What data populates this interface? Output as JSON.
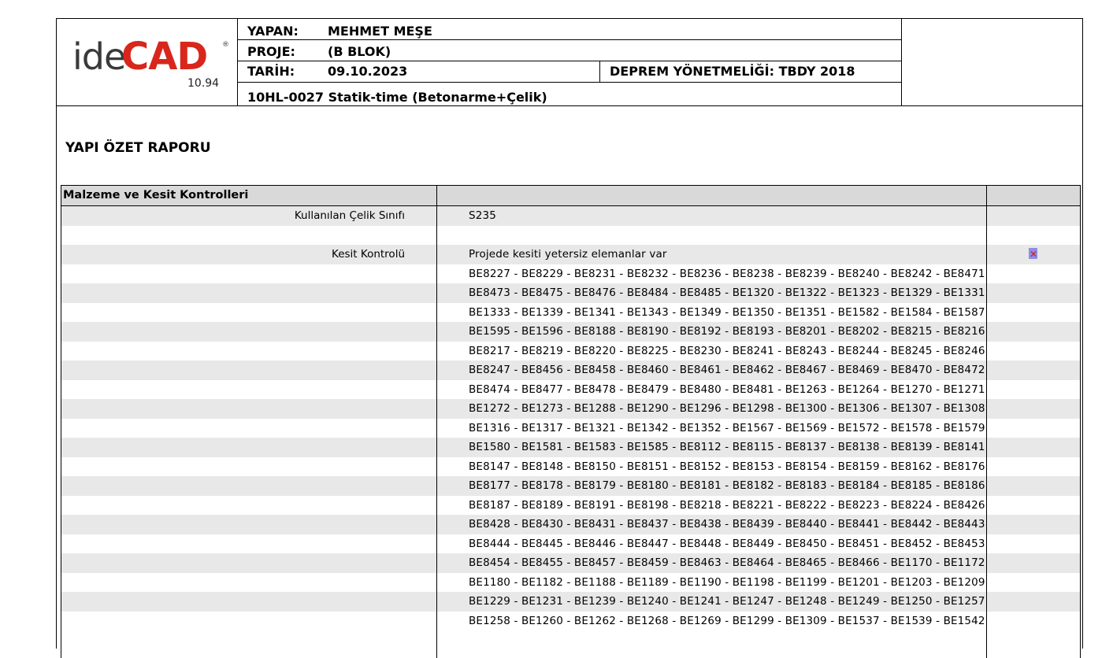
{
  "header": {
    "logo": {
      "ide": "ide",
      "cad": "CAD",
      "reg": "®",
      "version": "10.94"
    },
    "yapan_label": "YAPAN:",
    "yapan_value": "MEHMET MEŞE",
    "proje_label": "PROJE:",
    "proje_value": "(B BLOK)",
    "tarih_label": "TARİH:",
    "tarih_value": "09.10.2023",
    "deprem": "DEPREM YÖNETMELİĞİ: TBDY 2018",
    "project_code": "10HL-0027 Statik-time (Betonarme+Çelik)"
  },
  "report_title": "YAPI ÖZET RAPORU",
  "table": {
    "header": "Malzeme ve Kesit Kontrolleri",
    "rows": [
      {
        "label": "Kullanılan Çelik Sınıfı",
        "text": "S235",
        "shade": true
      },
      {
        "label": "",
        "text": "",
        "shade": false
      },
      {
        "label": "Kesit Kontrolü",
        "text": "Projede kesiti yetersiz elemanlar var",
        "shade": true,
        "status_icon": "x-fail-icon"
      },
      {
        "label": "",
        "text": "BE8227 - BE8229 - BE8231 - BE8232 - BE8236 - BE8238 - BE8239 - BE8240 - BE8242 - BE8471",
        "shade": false
      },
      {
        "label": "",
        "text": "BE8473 - BE8475 - BE8476 - BE8484 - BE8485 - BE1320 - BE1322 - BE1323 - BE1329 - BE1331",
        "shade": true
      },
      {
        "label": "",
        "text": "BE1333 - BE1339 - BE1341 - BE1343 - BE1349 - BE1350 - BE1351 - BE1582 - BE1584 - BE1587",
        "shade": false
      },
      {
        "label": "",
        "text": "BE1595 - BE1596 - BE8188 - BE8190 - BE8192 - BE8193 - BE8201 - BE8202 - BE8215 - BE8216",
        "shade": true
      },
      {
        "label": "",
        "text": "BE8217 - BE8219 - BE8220 - BE8225 - BE8230 - BE8241 - BE8243 - BE8244 - BE8245 - BE8246",
        "shade": false
      },
      {
        "label": "",
        "text": "BE8247 - BE8456 - BE8458 - BE8460 - BE8461 - BE8462 - BE8467 - BE8469 - BE8470 - BE8472",
        "shade": true
      },
      {
        "label": "",
        "text": "BE8474 - BE8477 - BE8478 - BE8479 - BE8480 - BE8481 - BE1263 - BE1264 - BE1270 - BE1271",
        "shade": false
      },
      {
        "label": "",
        "text": "BE1272 - BE1273 - BE1288 - BE1290 - BE1296 - BE1298 - BE1300 - BE1306 - BE1307 - BE1308",
        "shade": true
      },
      {
        "label": "",
        "text": "BE1316 - BE1317 - BE1321 - BE1342 - BE1352 - BE1567 - BE1569 - BE1572 - BE1578 - BE1579",
        "shade": false
      },
      {
        "label": "",
        "text": "BE1580 - BE1581 - BE1583 - BE1585 - BE8112 - BE8115 - BE8137 - BE8138 - BE8139 - BE8141",
        "shade": true
      },
      {
        "label": "",
        "text": "BE8147 - BE8148 - BE8150 - BE8151 - BE8152 - BE8153 - BE8154 - BE8159 - BE8162 - BE8176",
        "shade": false
      },
      {
        "label": "",
        "text": "BE8177 - BE8178 - BE8179 - BE8180 - BE8181 - BE8182 - BE8183 - BE8184 - BE8185 - BE8186",
        "shade": true
      },
      {
        "label": "",
        "text": "BE8187 - BE8189 - BE8191 - BE8198 - BE8218 - BE8221 - BE8222 - BE8223 - BE8224 - BE8426",
        "shade": false
      },
      {
        "label": "",
        "text": "BE8428 - BE8430 - BE8431 - BE8437 - BE8438 - BE8439 - BE8440 - BE8441 - BE8442 - BE8443",
        "shade": true
      },
      {
        "label": "",
        "text": "BE8444 - BE8445 - BE8446 - BE8447 - BE8448 - BE8449 - BE8450 - BE8451 - BE8452 - BE8453",
        "shade": false
      },
      {
        "label": "",
        "text": "BE8454 - BE8455 - BE8457 - BE8459 - BE8463 - BE8464 - BE8465 - BE8466 - BE1170 - BE1172",
        "shade": true
      },
      {
        "label": "",
        "text": "BE1180 - BE1182 - BE1188 - BE1189 - BE1190 - BE1198 - BE1199 - BE1201 - BE1203 - BE1209",
        "shade": false
      },
      {
        "label": "",
        "text": "BE1229 - BE1231 - BE1239 - BE1240 - BE1241 - BE1247 - BE1248 - BE1249 - BE1250 - BE1257",
        "shade": true
      },
      {
        "label": "",
        "text": "BE1258 - BE1260 - BE1262 - BE1268 - BE1269 - BE1299 - BE1309 - BE1537 - BE1539 - BE1542",
        "shade": false
      }
    ]
  }
}
